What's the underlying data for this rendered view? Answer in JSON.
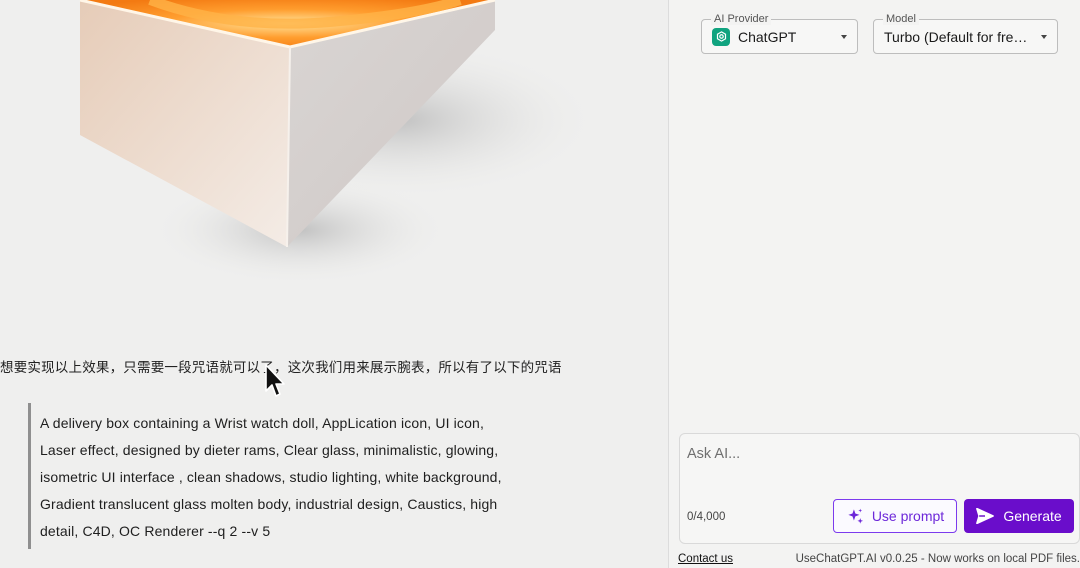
{
  "article": {
    "hero_image_alt": "isometric glowing box",
    "intro_text": "想要实现以上效果，只需要一段咒语就可以了，这次我们用来展示腕表，所以有了以下的咒语",
    "prompt_lines": [
      "A delivery box containing a Wrist watch doll, AppLication icon, UI icon,",
      "Laser effect, designed by dieter rams, Clear glass, minimalistic, glowing,",
      "isometric UI interface , clean shadows, studio lighting, white background,",
      "Gradient translucent glass molten body, industrial design, Caustics, high",
      "detail, C4D, OC Renderer --q 2 --v 5"
    ]
  },
  "panel": {
    "provider": {
      "legend": "AI Provider",
      "value": "ChatGPT",
      "icon": "chatgpt-logo-icon"
    },
    "model": {
      "legend": "Model",
      "value": "Turbo (Default for free …"
    },
    "ask": {
      "placeholder": "Ask AI...",
      "value": "",
      "counter": "0/4,000",
      "use_prompt_label": "Use prompt",
      "generate_label": "Generate"
    },
    "footer": {
      "contact_label": "Contact us",
      "version_text": "UseChatGPT.AI v0.0.25 - Now works on local PDF files."
    }
  },
  "colors": {
    "accent": "#6a0dcb",
    "accent_outline": "#7c3aed",
    "chatgpt_green": "#10a37f"
  }
}
